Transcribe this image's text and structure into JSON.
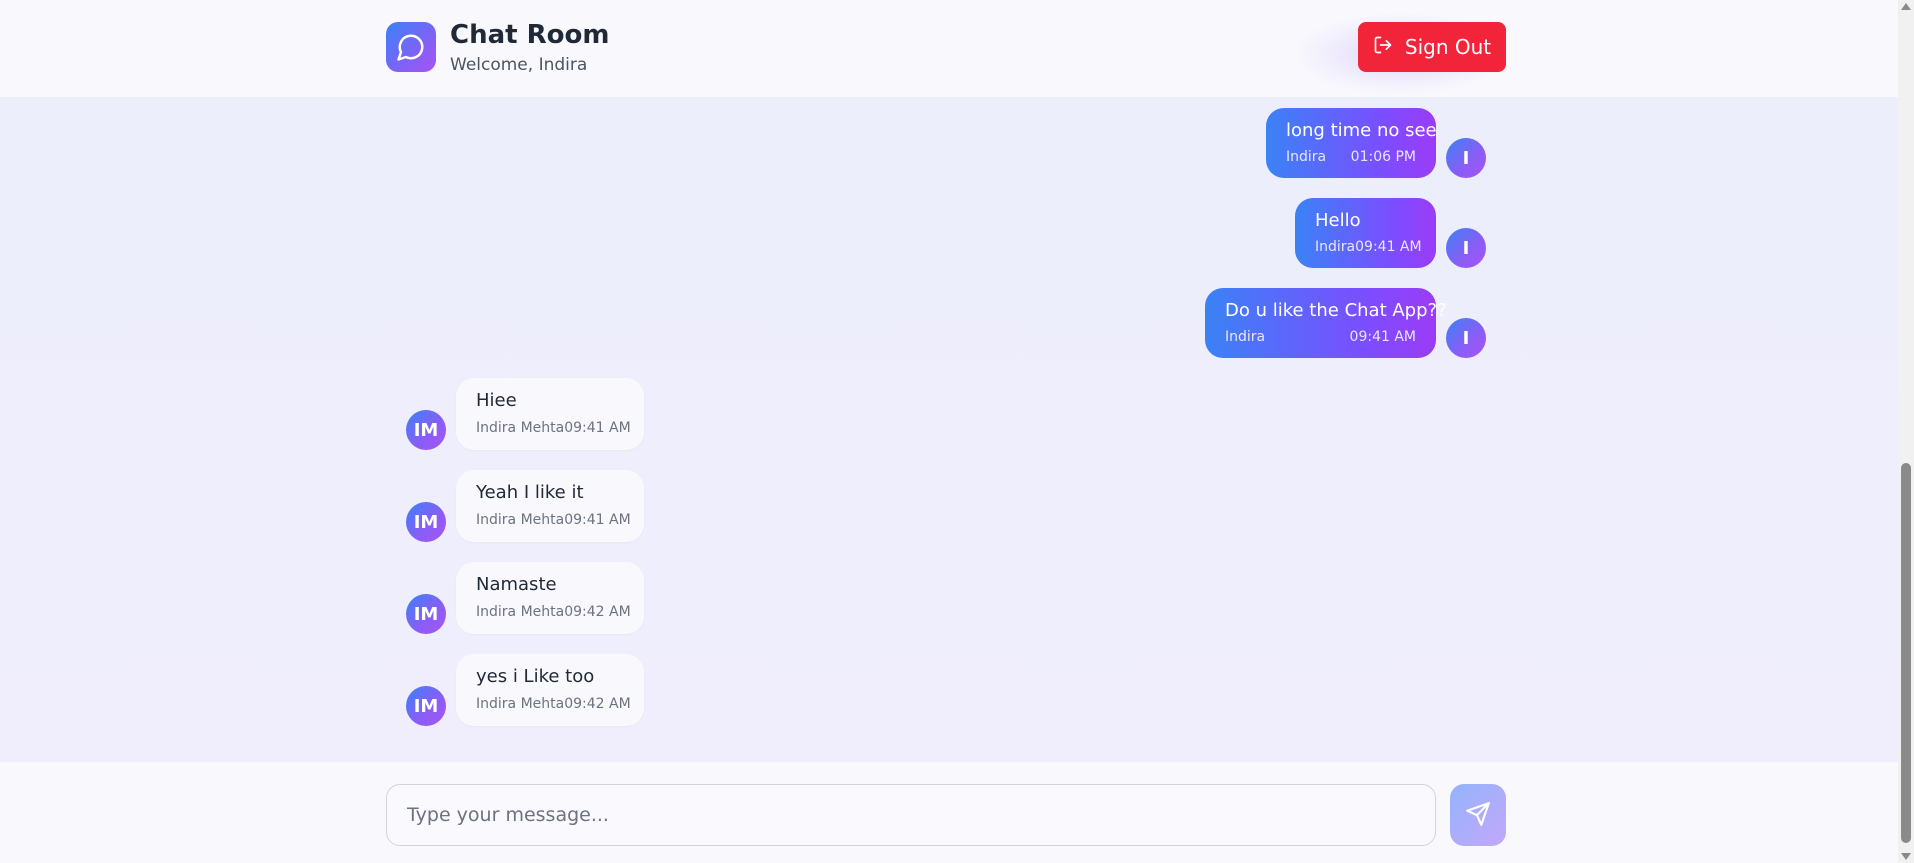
{
  "header": {
    "title": "Chat Room",
    "subtitle": "Welcome, Indira",
    "sign_out_label": "Sign Out"
  },
  "messages": [
    {
      "text": "long time no see",
      "sender": "Indira",
      "time": "01:06 PM",
      "avatar": "I",
      "outgoing": true
    },
    {
      "text": "Hello",
      "sender": "Indira",
      "time": "09:41 AM",
      "avatar": "I",
      "outgoing": true
    },
    {
      "text": "Do u like the Chat App??",
      "sender": "Indira",
      "time": "09:41 AM",
      "avatar": "I",
      "outgoing": true
    },
    {
      "text": "Hiee",
      "sender": "Indira Mehta",
      "time": "09:41 AM",
      "avatar": "IM",
      "outgoing": false
    },
    {
      "text": "Yeah I like it",
      "sender": "Indira Mehta",
      "time": "09:41 AM",
      "avatar": "IM",
      "outgoing": false
    },
    {
      "text": "Namaste",
      "sender": "Indira Mehta",
      "time": "09:42 AM",
      "avatar": "IM",
      "outgoing": false
    },
    {
      "text": "yes i Like too",
      "sender": "Indira Mehta",
      "time": "09:42 AM",
      "avatar": "IM",
      "outgoing": false
    }
  ],
  "composer": {
    "placeholder": "Type your message...",
    "value": ""
  },
  "icons": {
    "logo": "chat-bubble-icon",
    "sign_out": "logout-icon",
    "send": "send-icon"
  },
  "colors": {
    "accent_start": "#3b82f6",
    "accent_end": "#a855f7",
    "danger": "#f2243a"
  }
}
